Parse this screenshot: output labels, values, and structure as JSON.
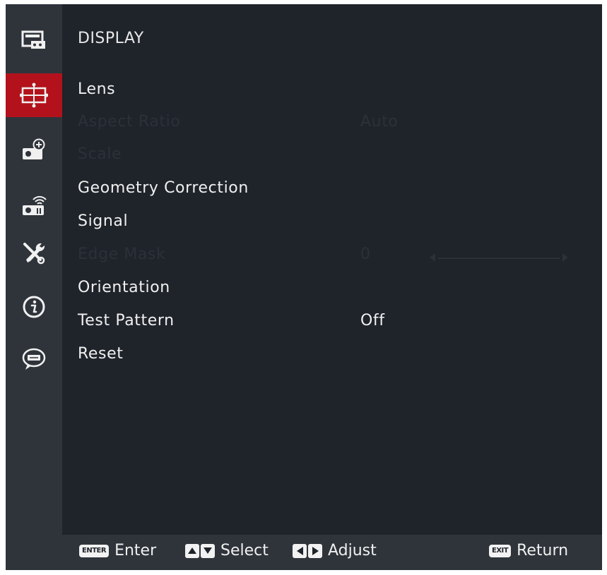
{
  "colors": {
    "background": "#1f232a",
    "sidebar": "#2f343b",
    "active": "#b3121c",
    "text": "#f0f0f0",
    "disabled_text": "#2c3038"
  },
  "sidebar": {
    "items": [
      {
        "icon": "picture-icon",
        "active": false
      },
      {
        "icon": "display-icon",
        "active": true
      },
      {
        "icon": "projector-add-icon",
        "active": false
      },
      {
        "icon": "projector-wifi-icon",
        "active": false
      },
      {
        "icon": "tools-icon",
        "active": false
      },
      {
        "icon": "info-icon",
        "active": false
      },
      {
        "icon": "language-abc-icon",
        "active": false
      }
    ]
  },
  "page": {
    "title": "DISPLAY"
  },
  "menu": {
    "lens": {
      "label": "Lens",
      "enabled": true
    },
    "aspect_ratio": {
      "label": "Aspect Ratio",
      "value": "Auto",
      "enabled": false
    },
    "scale": {
      "label": "Scale",
      "enabled": false
    },
    "geometry": {
      "label": "Geometry Correction",
      "enabled": true
    },
    "signal": {
      "label": "Signal",
      "enabled": true
    },
    "edge_mask": {
      "label": "Edge Mask",
      "value": "0",
      "enabled": false
    },
    "orientation": {
      "label": "Orientation",
      "enabled": true
    },
    "test_pattern": {
      "label": "Test Pattern",
      "value": "Off",
      "enabled": true
    },
    "reset": {
      "label": "Reset",
      "enabled": true
    }
  },
  "footer": {
    "enter_badge": "ENTER",
    "enter_label": "Enter",
    "select_label": "Select",
    "adjust_label": "Adjust",
    "exit_badge": "EXIT",
    "return_label": "Return"
  }
}
